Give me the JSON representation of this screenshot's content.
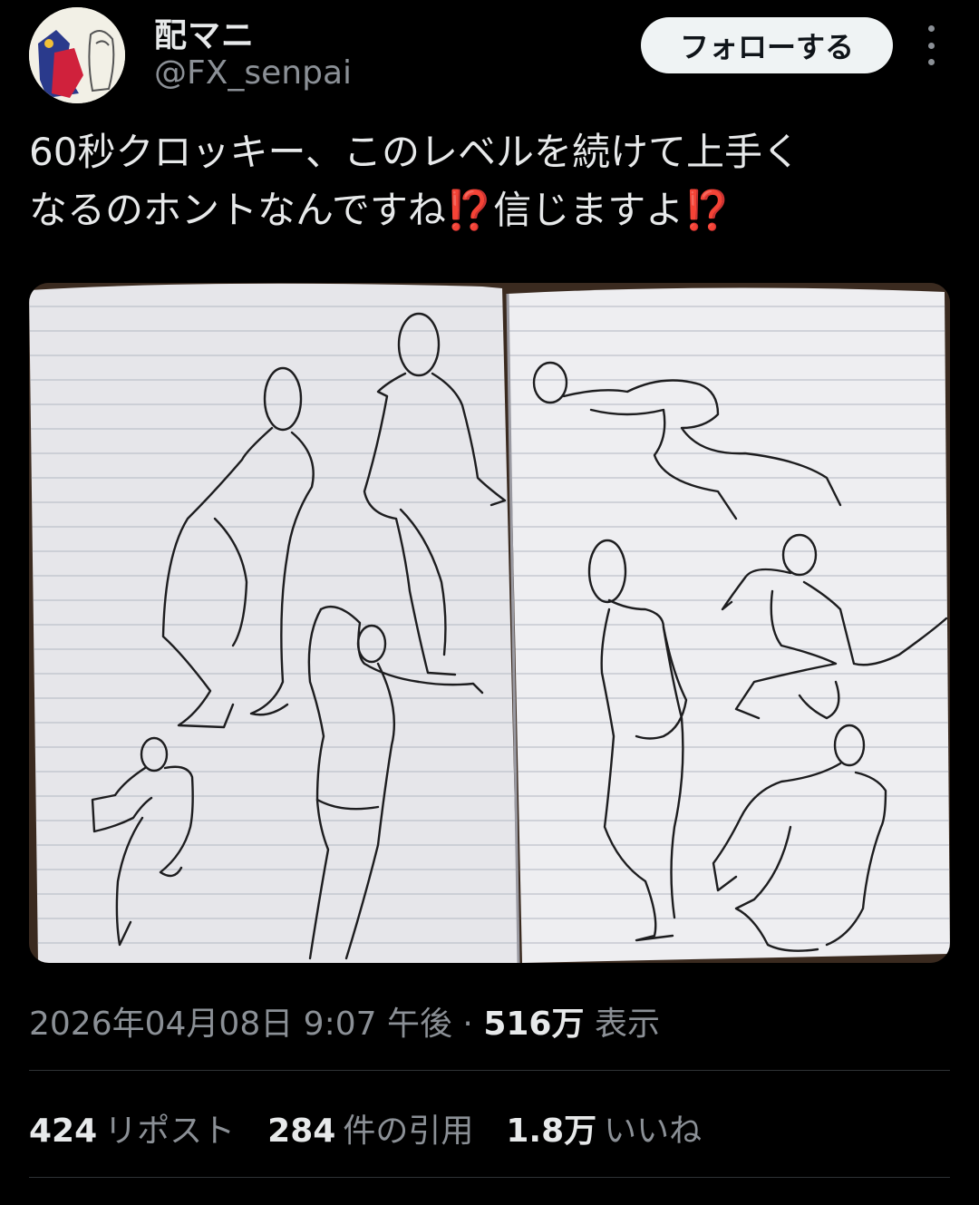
{
  "author": {
    "display_name": "配マニ",
    "handle": "@FX_senpai"
  },
  "header": {
    "follow_label": "フォローする"
  },
  "tweet": {
    "text_line1": "60秒クロッキー、このレベルを続けて上手く",
    "text_line2_a": "なるのホントなんですね",
    "emoji_1": "⁉️",
    "text_line2_b": "信じますよ",
    "emoji_2": "⁉️"
  },
  "meta": {
    "datetime": "2026年04月08日 9:07 午後",
    "separator": "·",
    "views_count": "516万",
    "views_label": "表示"
  },
  "stats": {
    "reposts_count": "424",
    "reposts_label": "リポスト",
    "quotes_count": "284",
    "quotes_label": "件の引用",
    "likes_count": "1.8万",
    "likes_label": "いいね"
  },
  "colors": {
    "background": "#000000",
    "text_primary": "#e7e9ea",
    "text_secondary": "#8b9096",
    "emoji_red": "#f4212e",
    "divider": "#2f3336"
  }
}
